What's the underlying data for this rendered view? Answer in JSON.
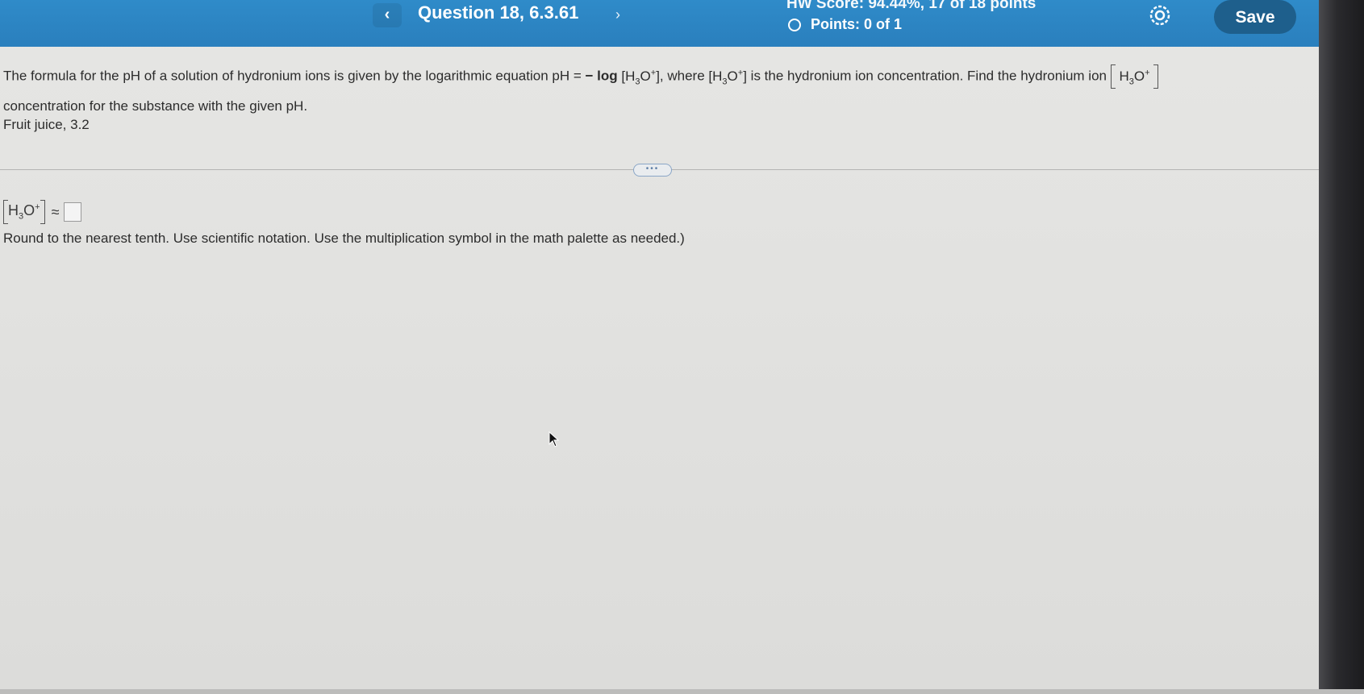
{
  "header": {
    "prev_icon": "chevron-left",
    "question_title": "Question 18, 6.3.61",
    "next_icon": "chevron-right",
    "hw_score": "HW Score: 94.44%, 17 of 18 points",
    "points": "Points: 0 of 1",
    "settings_icon": "gear",
    "save_label": "Save",
    "accent_color": "#2a82c2"
  },
  "problem": {
    "intro": "The formula for the pH of a solution of hydronium ions is given by the logarithmic equation pH = ",
    "log_term": "− log",
    "h3o": "H",
    "sub3": "3",
    "o": "O",
    "plus": "+",
    "mid": ", where ",
    "mid2": " is the hydronium ion concentration.  Find the hydronium ion ",
    "line2": "concentration for the substance with the given pH.",
    "substance": "Fruit juice, 3.2"
  },
  "divider": {
    "handle_label": "•••"
  },
  "answer": {
    "approx_symbol": "≈",
    "input_value": ""
  },
  "instruction": "Round to the nearest tenth. Use scientific notation. Use the multiplication symbol in the math palette as needed.)"
}
